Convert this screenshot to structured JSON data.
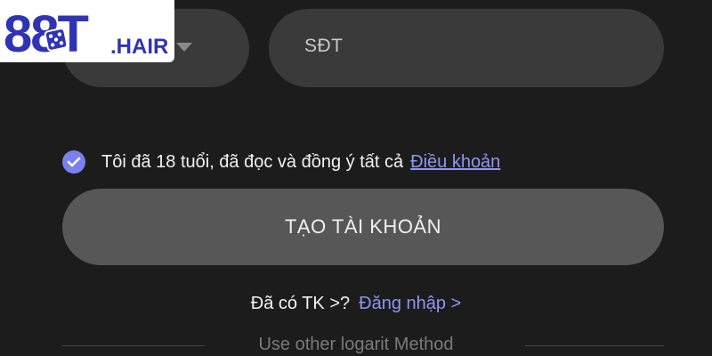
{
  "logo": {
    "text": "88T.HAIR",
    "main": "88T",
    "domain": ".HAIR",
    "icon": "dice-icon",
    "colors": {
      "main": "#2f34b6",
      "dice": "#2f34b6"
    }
  },
  "form": {
    "country_select": {
      "value": "",
      "icon": "chevron-down-icon"
    },
    "phone_input": {
      "placeholder": "SĐT"
    },
    "terms": {
      "checked": true,
      "text": "Tôi đã 18 tuổi, đã đọc và đồng ý tất cả",
      "link": "Điều khoản"
    },
    "submit_label": "TẠO TÀI KHOẢN"
  },
  "login": {
    "question": "Đã có TK >?",
    "link": "Đăng nhập >"
  },
  "other_method": "Use other logarit Method",
  "colors": {
    "background": "#1c1c1c",
    "field": "#3a3a3a",
    "button": "#575757",
    "accent": "#8f95f5",
    "checkbox": "#7b80ee"
  }
}
